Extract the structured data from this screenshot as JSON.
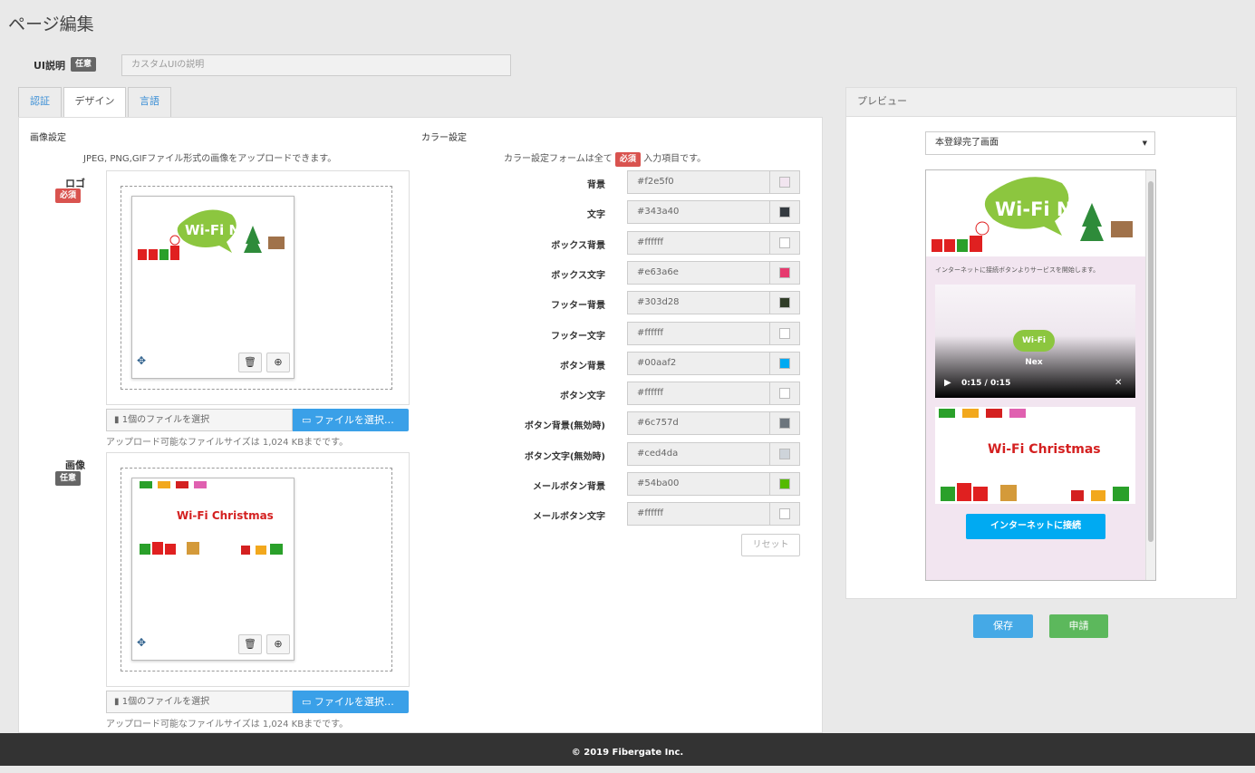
{
  "page": {
    "title": "ページ編集"
  },
  "ui_description": {
    "label": "UI説明",
    "badge": "任意",
    "placeholder": "カスタムUIの説明"
  },
  "tabs": [
    {
      "label": "認証",
      "active": false
    },
    {
      "label": "デザイン",
      "active": true
    },
    {
      "label": "言語",
      "active": false
    }
  ],
  "image_settings": {
    "title": "画像設定",
    "note": "JPEG, PNG,GIFファイル形式の画像をアップロードできます。",
    "logo": {
      "label": "ロゴ",
      "badge": "必須",
      "file_name_placeholder": "1個のファイルを選択",
      "file_button": "ファイルを選択…",
      "size_note": "アップロード可能なファイルサイズは 1,024 KBまでです。",
      "image_text": "Wi-Fi Nex"
    },
    "image": {
      "label": "画像",
      "badge": "任意",
      "file_name_placeholder": "1個のファイルを選択",
      "file_button": "ファイルを選択…",
      "size_note": "アップロード可能なファイルサイズは 1,024 KBまでです。",
      "image_text": "Wi-Fi Christmas"
    }
  },
  "color_settings": {
    "title": "カラー設定",
    "note_before": "カラー設定フォームは全て",
    "note_badge": "必須",
    "note_after": "入力項目です。",
    "rows": [
      {
        "label": "背景",
        "value": "#f2e5f0",
        "color": "#f2e5f0"
      },
      {
        "label": "文字",
        "value": "#343a40",
        "color": "#343a40"
      },
      {
        "label": "ボックス背景",
        "value": "#ffffff",
        "color": "#ffffff"
      },
      {
        "label": "ボックス文字",
        "value": "#e63a6e",
        "color": "#e63a6e"
      },
      {
        "label": "フッター背景",
        "value": "#303d28",
        "color": "#303d28"
      },
      {
        "label": "フッター文字",
        "value": "#ffffff",
        "color": "#ffffff"
      },
      {
        "label": "ボタン背景",
        "value": "#00aaf2",
        "color": "#00aaf2"
      },
      {
        "label": "ボタン文字",
        "value": "#ffffff",
        "color": "#ffffff"
      },
      {
        "label": "ボタン背景(無効時)",
        "value": "#6c757d",
        "color": "#6c757d"
      },
      {
        "label": "ボタン文字(無効時)",
        "value": "#ced4da",
        "color": "#ced4da"
      },
      {
        "label": "メールボタン背景",
        "value": "#54ba00",
        "color": "#54ba00"
      },
      {
        "label": "メールボタン文字",
        "value": "#ffffff",
        "color": "#ffffff"
      }
    ],
    "reset_button": "リセット"
  },
  "preview": {
    "title": "プレビュー",
    "selected_screen": "本登録完了画面",
    "message": "インターネットに接続ボタンよりサービスを開始します。",
    "video_time": "0:15 / 0:15",
    "video_logo": "Wi-Fi Nex",
    "banner_text": "Wi-Fi Christmas",
    "logo_text": "Wi-Fi Nex",
    "connect_button": "インターネットに接続"
  },
  "actions": {
    "save": "保存",
    "apply": "申請"
  },
  "footer": {
    "copyright": "© 2019 Fibergate Inc."
  }
}
